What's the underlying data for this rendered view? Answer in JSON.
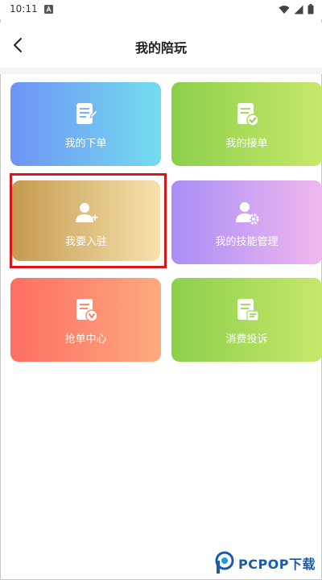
{
  "status_bar": {
    "time": "10:11"
  },
  "header": {
    "title": "我的陪玩"
  },
  "cards": [
    {
      "label": "我的下单",
      "icon": "order-document-icon"
    },
    {
      "label": "我的接单",
      "icon": "accept-order-check-icon"
    },
    {
      "label": "我要入驻",
      "icon": "add-user-icon"
    },
    {
      "label": "我的技能管理",
      "icon": "user-settings-icon"
    },
    {
      "label": "抢单中心",
      "icon": "grab-order-icon"
    },
    {
      "label": "消费投诉",
      "icon": "complaint-document-icon"
    }
  ],
  "watermark": {
    "text": "PCPOP下载"
  },
  "colors": {
    "highlight_border": "#d9141a",
    "watermark": "#1f5aa8"
  }
}
